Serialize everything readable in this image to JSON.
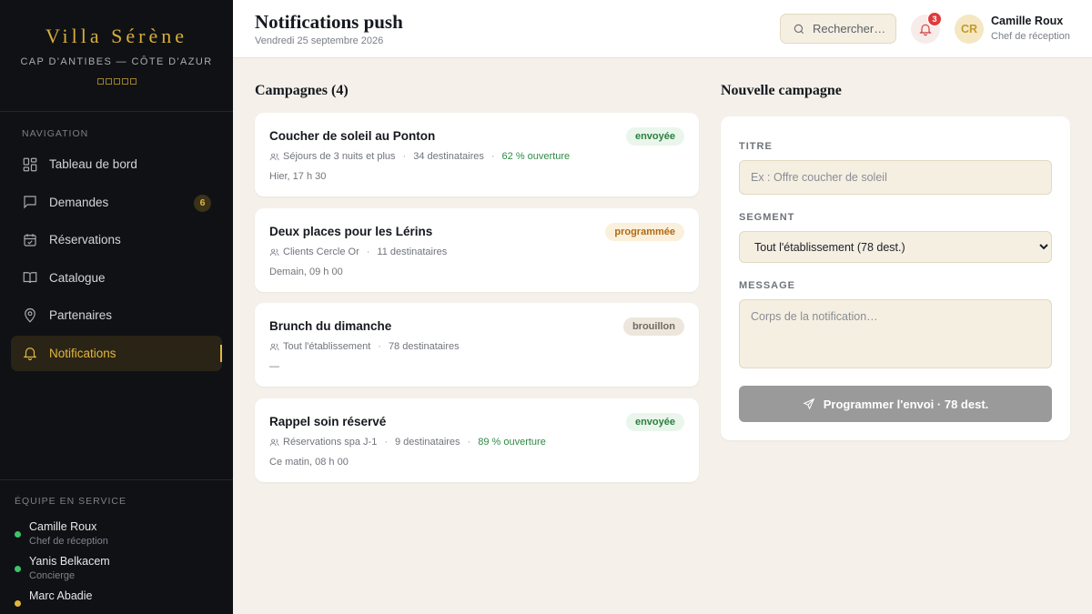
{
  "brand": {
    "name": "Villa Sérène",
    "tagline": "CAP D'ANTIBES — CÔTE D'AZUR"
  },
  "sidebar": {
    "nav_label": "NAVIGATION",
    "items": [
      {
        "label": "Tableau de bord",
        "icon": "grid-icon"
      },
      {
        "label": "Demandes",
        "icon": "message-icon",
        "count": "6"
      },
      {
        "label": "Réservations",
        "icon": "calendar-check-icon"
      },
      {
        "label": "Catalogue",
        "icon": "book-icon"
      },
      {
        "label": "Partenaires",
        "icon": "map-pin-icon"
      },
      {
        "label": "Notifications",
        "icon": "bell-icon",
        "active": true
      }
    ],
    "team_label": "ÉQUIPE EN SERVICE",
    "team": [
      {
        "name": "Camille Roux",
        "role": "Chef de réception",
        "status": "online"
      },
      {
        "name": "Yanis Belkacem",
        "role": "Concierge",
        "status": "online"
      },
      {
        "name": "Marc Abadie",
        "role": "",
        "status": "busy"
      }
    ]
  },
  "header": {
    "title": "Notifications push",
    "date": "Vendredi 25 septembre 2026",
    "search_placeholder": "Rechercher…",
    "notification_count": "3",
    "user": {
      "initials": "CR",
      "name": "Camille Roux",
      "role": "Chef de réception"
    }
  },
  "campaigns": {
    "title": "Campagnes (4)",
    "items": [
      {
        "title": "Coucher de soleil au Ponton",
        "segment": "Séjours de 3 nuits et plus",
        "recipients": "34 destinataires",
        "open_rate": "62 % ouverture",
        "time": "Hier, 17 h 30",
        "status": "envoyée"
      },
      {
        "title": "Deux places pour les Lérins",
        "segment": "Clients Cercle Or",
        "recipients": "11 destinataires",
        "open_rate": "",
        "time": "Demain, 09 h 00",
        "status": "programmée"
      },
      {
        "title": "Brunch du dimanche",
        "segment": "Tout l'établissement",
        "recipients": "78 destinataires",
        "open_rate": "",
        "time": "—",
        "status": "brouillon"
      },
      {
        "title": "Rappel soin réservé",
        "segment": "Réservations spa J-1",
        "recipients": "9 destinataires",
        "open_rate": "89 % ouverture",
        "time": "Ce matin, 08 h 00",
        "status": "envoyée"
      }
    ]
  },
  "form": {
    "title": "Nouvelle campagne",
    "title_label": "TITRE",
    "title_placeholder": "Ex : Offre coucher de soleil",
    "segment_label": "SEGMENT",
    "segment_value": "Tout l'établissement (78 dest.)",
    "message_label": "MESSAGE",
    "message_placeholder": "Corps de la notification…",
    "submit_label": "Programmer l'envoi · 78 dest."
  },
  "colors": {
    "accent": "#e2b63d",
    "sidebar_bg": "#0f1115",
    "page_bg": "#f5f1ea",
    "sent": "#2a7f3d",
    "scheduled": "#b06a12",
    "alert": "#e03a3a"
  }
}
